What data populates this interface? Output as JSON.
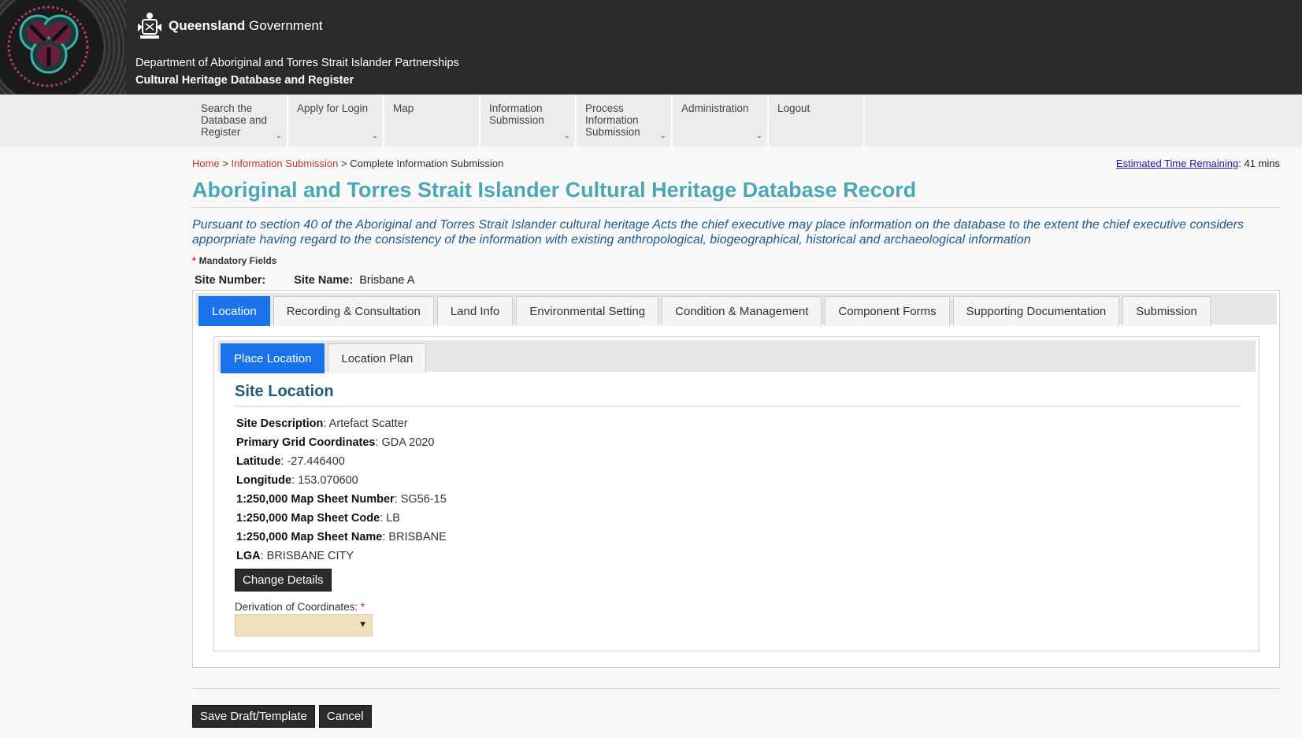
{
  "header": {
    "gov_bold": "Queensland",
    "gov_regular": "Government",
    "department": "Department of Aboriginal and Torres Strait Islander Partnerships",
    "system_name": "Cultural Heritage Database and Register"
  },
  "nav": {
    "items": [
      {
        "label": "Search the Database and Register",
        "has_dropdown": true
      },
      {
        "label": "Apply for Login",
        "has_dropdown": true
      },
      {
        "label": "Map",
        "has_dropdown": false
      },
      {
        "label": "Information Submission",
        "has_dropdown": true
      },
      {
        "label": "Process Information Submission",
        "has_dropdown": true
      },
      {
        "label": "Administration",
        "has_dropdown": true
      },
      {
        "label": "Logout",
        "has_dropdown": false
      }
    ]
  },
  "breadcrumb": {
    "home": "Home",
    "sep1": ">",
    "info_submission": "Information Submission",
    "sep2": ">",
    "current": "Complete Information Submission"
  },
  "time_remaining": {
    "label": "Estimated Time Remaining",
    "value": ": 41 mins"
  },
  "page": {
    "title": "Aboriginal and Torres Strait Islander Cultural Heritage Database Record",
    "lede": "Pursuant to section 40 of the Aboriginal and Torres Strait Islander cultural heritage Acts the chief executive may place information on the database to the extent the chief executive considers apporpriate having regard to the consistency of the information with existing anthropological, biogeographical, historical and archaeological information",
    "mandatory_star": "*",
    "mandatory_label": "Mandatory Fields",
    "site_number_label": "Site Number:",
    "site_number_value": "",
    "site_name_label": "Site Name:",
    "site_name_value": "Brisbane A"
  },
  "tabs": [
    {
      "label": "Location",
      "active": true
    },
    {
      "label": "Recording & Consultation",
      "active": false
    },
    {
      "label": "Land Info",
      "active": false
    },
    {
      "label": "Environmental Setting",
      "active": false
    },
    {
      "label": "Condition & Management",
      "active": false
    },
    {
      "label": "Component Forms",
      "active": false
    },
    {
      "label": "Supporting Documentation",
      "active": false
    },
    {
      "label": "Submission",
      "active": false
    }
  ],
  "subtabs": [
    {
      "label": "Place Location",
      "active": true
    },
    {
      "label": "Location Plan",
      "active": false
    }
  ],
  "site_location": {
    "heading": "Site Location",
    "fields": [
      {
        "label": "Site Description",
        "value": ": Artefact Scatter"
      },
      {
        "label": "Primary Grid Coordinates",
        "value": ": GDA 2020"
      },
      {
        "label": "Latitude",
        "value": ": -27.446400"
      },
      {
        "label": "Longitude",
        "value": ": 153.070600"
      },
      {
        "label": "1:250,000 Map Sheet Number",
        "value": ": SG56-15"
      },
      {
        "label": "1:250,000 Map Sheet Code",
        "value": ": LB"
      },
      {
        "label": "1:250,000 Map Sheet Name",
        "value": ": BRISBANE"
      },
      {
        "label": "LGA",
        "value": ": BRISBANE CITY"
      }
    ],
    "change_button": "Change Details",
    "derivation_label": "Derivation of Coordinates:",
    "derivation_star": "*",
    "derivation_value": ""
  },
  "footer": {
    "save_button": "Save Draft/Template",
    "cancel_button": "Cancel"
  },
  "colors": {
    "header_bg": "#2a2a2a",
    "title": "#4aa8b4",
    "tab_active": "#1a73e8",
    "link_red": "#c0392b",
    "select_bg": "#efe0bb"
  }
}
